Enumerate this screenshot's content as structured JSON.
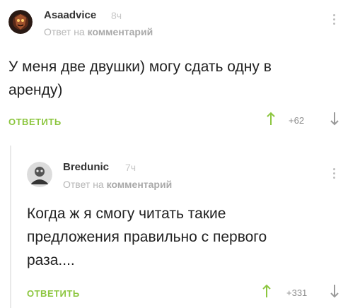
{
  "comments": [
    {
      "author": "Asaadvice",
      "time": "8ч",
      "reply_prefix": "Ответ на",
      "reply_target": "комментарий",
      "text_lines": [
        "У меня две двушки) могу сдать одну в",
        "аренду)"
      ],
      "reply_label": "ОТВЕТИТЬ",
      "score": "+62"
    },
    {
      "author": "Bredunic",
      "time": "7ч",
      "reply_prefix": "Ответ на",
      "reply_target": "комментарий",
      "text_lines": [
        "Когда ж я смогу читать такие",
        "предложения правильно с первого",
        "раза...."
      ],
      "reply_label": "ОТВЕТИТЬ",
      "score": "+331"
    }
  ],
  "colors": {
    "accent_green": "#8cc63f",
    "muted_text": "#b5b5b5",
    "body_text": "#222222",
    "thread_line": "#e9e9e9"
  },
  "icons": [
    "avatar",
    "kebab-menu-icon",
    "arrow-up-icon",
    "arrow-down-icon"
  ]
}
